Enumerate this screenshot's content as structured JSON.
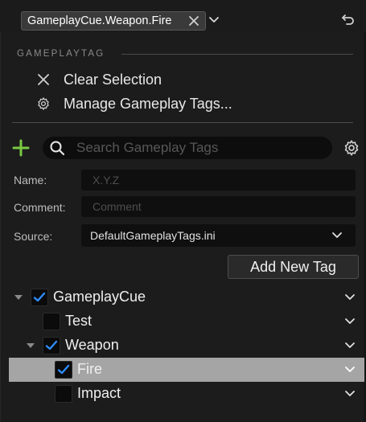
{
  "top_bar": {
    "selected_tag": "GameplayCue.Weapon.Fire"
  },
  "menu": {
    "section_header": "GAMEPLAYTAG",
    "items": [
      {
        "label": "Clear Selection",
        "icon": "close-icon"
      },
      {
        "label": "Manage Gameplay Tags...",
        "icon": "gear-icon"
      }
    ]
  },
  "search": {
    "placeholder": "Search Gameplay Tags",
    "value": ""
  },
  "form": {
    "name_label": "Name:",
    "name_placeholder": "X.Y.Z",
    "comment_label": "Comment:",
    "comment_placeholder": "Comment",
    "source_label": "Source:",
    "source_value": "DefaultGameplayTags.ini",
    "add_button_label": "Add New Tag"
  },
  "tree": {
    "rows": [
      {
        "label": "GameplayCue",
        "checked": true,
        "expanded": true,
        "depth": 0
      },
      {
        "label": "Test",
        "checked": false,
        "expanded": false,
        "depth": 1
      },
      {
        "label": "Weapon",
        "checked": true,
        "expanded": true,
        "depth": 1
      },
      {
        "label": "Fire",
        "checked": true,
        "expanded": false,
        "depth": 2,
        "selected": true
      },
      {
        "label": "Impact",
        "checked": false,
        "expanded": false,
        "depth": 2
      }
    ]
  },
  "colors": {
    "accent_green": "#7ac943",
    "checkmark_blue": "#2f8cff",
    "selected_row": "#a5a5a5"
  }
}
